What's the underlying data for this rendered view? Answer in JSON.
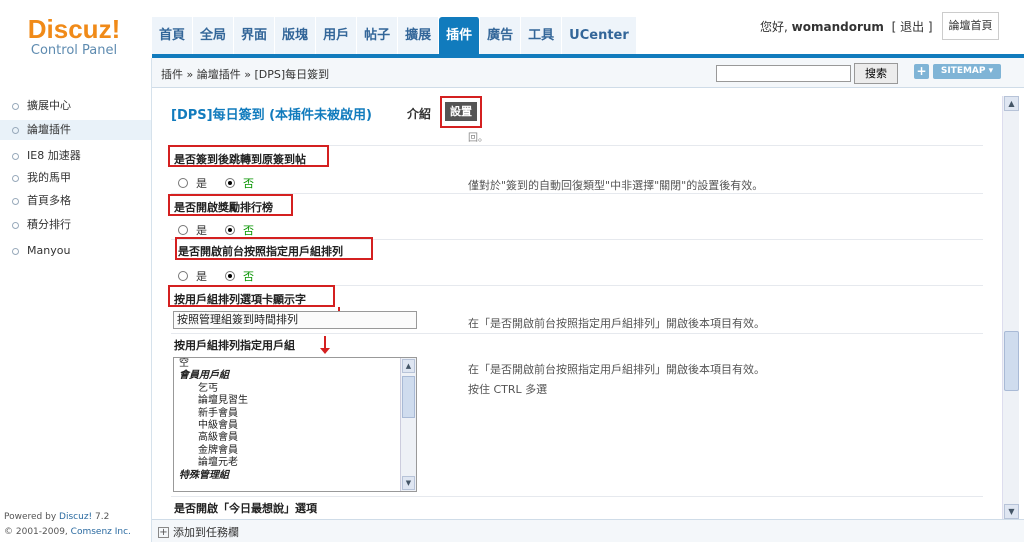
{
  "header": {
    "logo_brand": "Discuz!",
    "logo_sub": "Control Panel",
    "nav": [
      "首頁",
      "全局",
      "界面",
      "版塊",
      "用戶",
      "帖子",
      "擴展",
      "插件",
      "廣告",
      "工具",
      "UCenter"
    ],
    "nav_active_index": 7,
    "greeting_prefix": "您好,",
    "username": "womandorum",
    "logout": "[ 退出 ]",
    "forum_home": "論壇首頁"
  },
  "sidebar": {
    "items": [
      "擴展中心",
      "論壇插件",
      "IE8 加速器",
      "我的馬甲",
      "首頁多格",
      "積分排行",
      "Manyou"
    ],
    "active_index": 1
  },
  "breadcrumb": "插件 » 論壇插件 » [DPS]每日簽到",
  "search": {
    "button": "搜索",
    "value": ""
  },
  "sitemap": {
    "plus": "+",
    "label": "SITEMAP ▾"
  },
  "plugin": {
    "title": "[DPS]每日簽到 (本插件未被啟用)",
    "tab_intro": "介紹",
    "tab_settings": "設置",
    "top_fragment": "回。"
  },
  "settings": [
    {
      "label": "是否簽到後跳轉到原簽到帖",
      "yes": "是",
      "no": "否",
      "hint": "僅對於\"簽到的自動回復類型\"中非選擇\"關閉\"的設置後有效。"
    },
    {
      "label": "是否開啟獎勵排行榜",
      "yes": "是",
      "no": "否",
      "hint": ""
    },
    {
      "label": "是否開啟前台按照指定用戶組排列",
      "yes": "是",
      "no": "否",
      "hint": ""
    },
    {
      "label": "按用戶組排列選項卡顯示字",
      "value": "按照管理組簽到時間排列",
      "hint": "在「是否開啟前台按照指定用戶組排列」開啟後本項目有效。"
    },
    {
      "label": "按用戶組排列指定用戶組",
      "hint": "在「是否開啟前台按照指定用戶組排列」開啟後本項目有效。",
      "hint2": "按住 CTRL 多選",
      "options": [
        {
          "text": "空",
          "type": "normal"
        },
        {
          "text": "會員用戶組",
          "type": "group"
        },
        {
          "text": "乞丐",
          "type": "child"
        },
        {
          "text": "論壇見習生",
          "type": "child"
        },
        {
          "text": "新手會員",
          "type": "child"
        },
        {
          "text": "中級會員",
          "type": "child"
        },
        {
          "text": "高級會員",
          "type": "child"
        },
        {
          "text": "金牌會員",
          "type": "child"
        },
        {
          "text": "論壇元老",
          "type": "child"
        },
        {
          "text": "特殊管理組",
          "type": "group"
        }
      ]
    },
    {
      "label": "是否開啟「今日最想說」選項"
    }
  ],
  "footer": {
    "powered_prefix": "Powered by",
    "powered_brand": "Discuz!",
    "version": "7.2",
    "copyright_prefix": "© 2001-2009,",
    "copyright_brand": "Comsenz Inc.",
    "add_task": "添加到任務欄"
  },
  "colors": {
    "accent": "#117bbd",
    "logo": "#f08a18",
    "highlight": "#d42020",
    "no_option": "#079400"
  }
}
